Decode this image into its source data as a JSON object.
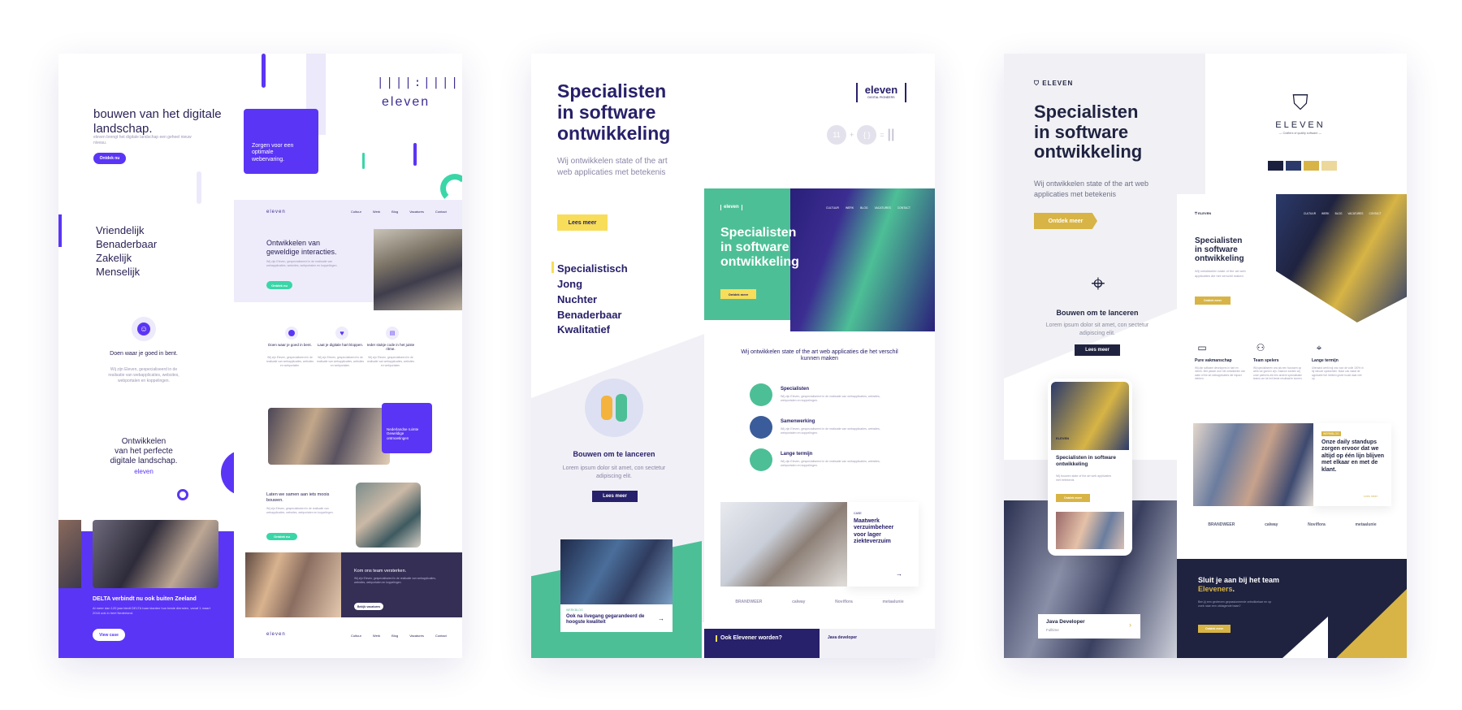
{
  "board1": {
    "logo": "eleven",
    "hero": {
      "title": "bouwen van het digitale landschap.",
      "subtitle": "eleven brengt het digitale landschap een geheel nieuw niveau.",
      "button": "Ontdek nu"
    },
    "card": {
      "text": "Zorgen voor een optimale webervaring."
    },
    "values": [
      "Vriendelijk",
      "Benaderbaar",
      "Zakelijk",
      "Menselijk"
    ],
    "good": {
      "title": "Doen waar je goed in bent.",
      "text": "Wij zijn Eleven, gespecialiseerd in de realisatie van webapplicaties, websites, webportalen en koppelingen."
    },
    "perfect": {
      "line1": "Ontwikkelen",
      "line2": "van het perfecte",
      "line3": "digitale landschap.",
      "brand": "eleven"
    },
    "delta": {
      "title": "DELTA verbindt nu ook buiten Zeeland",
      "text": "Al meer dan 120 jaar biedt DELTA haar klanten hun beste diensten, vanaf 1 maart 2018 ook in heel Nederland.",
      "button": "View case"
    },
    "site": {
      "logo": "eleven",
      "nav": [
        "Cultuur",
        "Werk",
        "Blog",
        "Vacatures",
        "Contact"
      ],
      "hero": {
        "title": "Ontwikkelen van geweldige interacties.",
        "text": "Wij zijn Eleven, gespecialiseerd in de realisatie van webapplicaties, websites, webportalen en koppelingen.",
        "button": "Ontdek nu"
      },
      "features": [
        {
          "title": "Doen waar je goed in bent.",
          "text": "Wij zijn Eleven, gespecialiseerd in de realisatie van webapplicaties, websites en webportalen."
        },
        {
          "title": "Laat je digitale hart kloppen.",
          "text": "Wij zijn Eleven, gespecialiseerd in de realisatie van webapplicaties, websites en webportalen."
        },
        {
          "title": "Ieder stukje code in het juiste ritme.",
          "text": "Wij zijn Eleven, gespecialiseerd in de realisatie van webapplicaties, websites en webportalen."
        }
      ],
      "quote": "Nederlandse ruimte Geweldige ontmoetingen",
      "build": {
        "title": "Laten we samen aan iets moois bouwen.",
        "text": "Wij zijn Eleven, gespecialiseerd in de realisatie van webapplicaties, websites, webportalen en koppelingen.",
        "button": "Ontdek nu"
      },
      "team": {
        "title": "Kom ons team versterken.",
        "text": "Wij zijn Eleven, gespecialiseerd in de realisatie van webapplicaties, websites, webportalen en koppelingen.",
        "button": "Bekijk vacatures"
      },
      "footer_nav": [
        "Cultuur",
        "Werk",
        "Blog",
        "Vacatures",
        "Contact"
      ]
    }
  },
  "board2": {
    "logo": "eleven",
    "logo_sub": "DIGITAL PIONEERS",
    "equation": [
      "11",
      "+",
      "{ }",
      "=",
      "||"
    ],
    "hero": {
      "title_l1": "Specialisten",
      "title_l2": "in software",
      "title_l3": "ontwikkeling",
      "subtitle": "Wij ontwikkelen state of the art web applicaties met betekenis",
      "button": "Lees meer"
    },
    "traits": [
      "Specialistisch",
      "Jong",
      "Nuchter",
      "Benaderbaar",
      "Kwalitatief"
    ],
    "launch": {
      "title": "Bouwen om te lanceren",
      "text": "Lorem ipsum dolor sit amet, con sectetur adipiscing elit.",
      "button": "Lees meer"
    },
    "news": {
      "tag": "WERKBLOG",
      "title": "Ook na livegang gegarandeerd de hoogste kwaliteit"
    },
    "site": {
      "logo": "eleven",
      "nav": [
        "CULTUUR",
        "WERK",
        "BLOG",
        "VACATURES",
        "CONTACT"
      ],
      "hero_l1": "Specialisten",
      "hero_l2": "in software",
      "hero_l3": "ontwikkeling",
      "button": "Ontdek meer",
      "intro": "Wij ontwikkelen state of the art web applicaties die het verschil kunnen maken",
      "features": [
        {
          "title": "Specialisten",
          "text": "Wij zijn Eleven, gespecialiseerd in de realisatie van webapplicaties, websites, webportalen en koppelingen."
        },
        {
          "title": "Samenwerking",
          "text": "Wij zijn Eleven, gespecialiseerd in de realisatie van webapplicaties, websites, webportalen en koppelingen."
        },
        {
          "title": "Lange termijn",
          "text": "Wij zijn Eleven, gespecialiseerd in de realisatie van webapplicaties, websites, webportalen en koppelingen."
        }
      ],
      "case": {
        "tag": "CASE",
        "title": "Maatwerk verzuimbeheer voor lager ziekteverzuim"
      },
      "clients": [
        "BRANDWEER",
        "calway",
        "Noviflora",
        "metaalunie"
      ],
      "join": {
        "title": "Ook Elevener worden?",
        "job": "Java developer"
      }
    }
  },
  "board3": {
    "logo": "ELEVEN",
    "hero": {
      "title_l1": "Specialisten",
      "title_l2": "in software",
      "title_l3": "ontwikkeling",
      "subtitle": "Wij ontwikkelen state of the art web applicaties met betekenis",
      "button": "Ontdek meer"
    },
    "brand": {
      "name": "ELEVEN",
      "tagline": "— Crafters of quality software —"
    },
    "swatches": [
      "#1a1f3d",
      "#2b3a6b",
      "#d7b445",
      "#ecd89a"
    ],
    "launch": {
      "title": "Bouwen om te lanceren",
      "text": "Lorem ipsum dolor sit amet, con sectetur adipiscing elit.",
      "button": "Lees meer"
    },
    "mobile": {
      "logo": "ELEVEN",
      "title": "Specialisten in software ontwikkeling",
      "text": "Wij bouwen state of the art web applicaties met betekenis",
      "button": "Ontdek meer"
    },
    "job": {
      "title": "Java Developer",
      "type": "Fulltime"
    },
    "site": {
      "logo": "ELEVEN",
      "nav": [
        "CULTUUR",
        "WERK",
        "BLOG",
        "VACATURES",
        "CONTACT"
      ],
      "hero": {
        "title_l1": "Specialisten",
        "title_l2": "in software",
        "title_l3": "ontwikkeling",
        "text": "Wij ontwikkelen state of the art web applicaties die het verschil maken",
        "button": "Ontdek meer"
      },
      "features": [
        {
          "title": "Pure vakmanschap",
          "text": "Wij zijn software developers in hart en nieren. Met passie voor het ontwikkelen van state of the art webapplicaties die impact hebben."
        },
        {
          "title": "Team spelers",
          "text": "Wij specialiseren ons als een focussen op werk we goed in zijn. Daarom zoeken wij onze partners die een andere specialisatie teams om tot het beste resultaat te komen."
        },
        {
          "title": "Lange termijn",
          "text": "Uiteraard werkt wij ons voor de volle 100% in bij nieuwe opdrachten. Maar ook nadat de applicatie live hebben gezet houdt daar niet op."
        }
      ],
      "quote": {
        "tag": "WERKBLOG",
        "text": "Onze daily standups zorgen ervoor dat we altijd op één lijn blijven met elkaar en met de klant.",
        "link": "Lees meer"
      },
      "clients": [
        "BRANDWEER",
        "calway",
        "Noviflora",
        "metaalunie"
      ],
      "join": {
        "title_l1": "Sluit je aan bij het",
        "title_l2": "team",
        "title_brand": "Eleveners",
        "dot": ".",
        "text": "Ben jij een gedreven gepassioneerde ontwikkelaar en op zoek naar een uitdagende baan?",
        "button": "Ontdek meer"
      }
    }
  }
}
